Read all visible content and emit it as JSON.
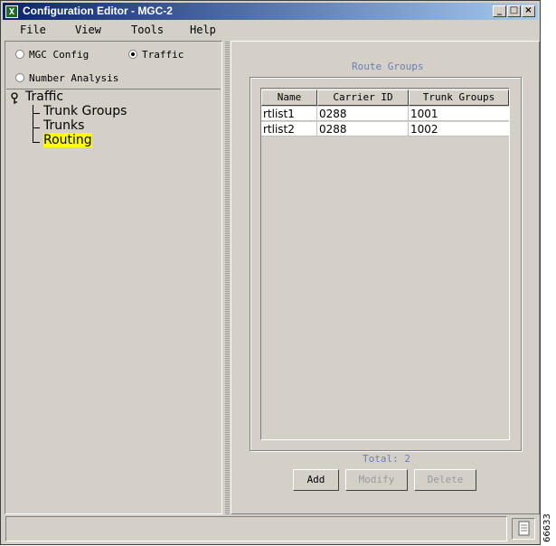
{
  "window": {
    "title": "Configuration Editor - MGC-2",
    "app_icon": "X"
  },
  "menu": [
    "File",
    "View",
    "Tools",
    "Help"
  ],
  "modes": [
    {
      "label": "MGC Config",
      "selected": false
    },
    {
      "label": "Traffic",
      "selected": true
    },
    {
      "label": "Number Analysis",
      "selected": false
    }
  ],
  "tree": {
    "root": "Traffic",
    "children": [
      "Trunk Groups",
      "Trunks",
      "Routing"
    ],
    "selected": "Routing"
  },
  "route_groups": {
    "title": "Route Groups",
    "columns": [
      "Name",
      "Carrier ID",
      "Trunk Groups"
    ],
    "rows": [
      [
        "rtlist1",
        "0288",
        "1001"
      ],
      [
        "rtlist2",
        "0288",
        "1002"
      ]
    ],
    "total": "Total: 2"
  },
  "buttons": {
    "add": "Add",
    "modify": "Modify",
    "delete": "Delete"
  },
  "figure_number": "66633",
  "colors": {
    "title_bar": "#0a246a",
    "highlight": "#ffff00",
    "caption_text": "#6b7fb5"
  }
}
